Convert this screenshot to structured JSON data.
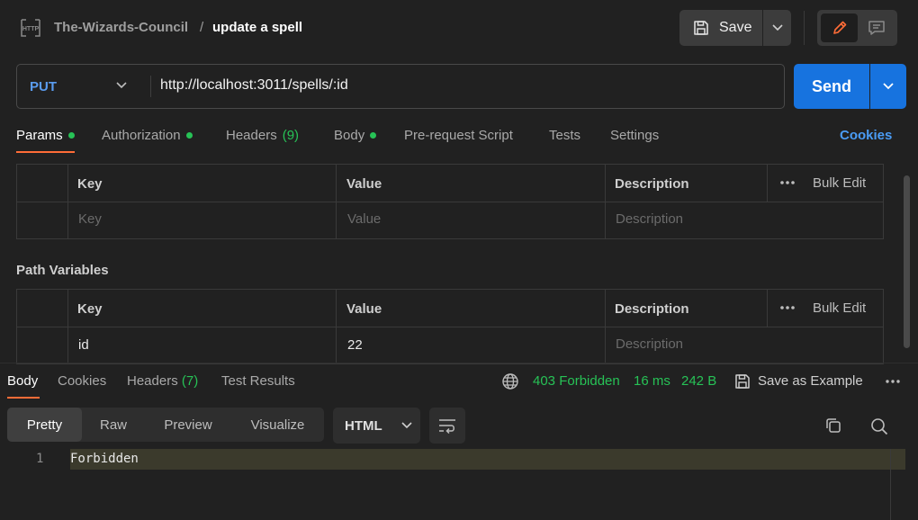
{
  "header": {
    "workspace": "The-Wizards-Council",
    "separator": "/",
    "request_name": "update a spell",
    "save_label": "Save"
  },
  "request": {
    "method": "PUT",
    "url": "http://localhost:3011/spells/:id",
    "send_label": "Send"
  },
  "tabs": {
    "params": "Params",
    "authorization": "Authorization",
    "headers": "Headers",
    "headers_count": "(9)",
    "body": "Body",
    "prerequest": "Pre-request Script",
    "tests": "Tests",
    "settings": "Settings",
    "cookies": "Cookies"
  },
  "query_params": {
    "columns": [
      "Key",
      "Value",
      "Description"
    ],
    "bulk_edit": "Bulk Edit",
    "placeholders": {
      "key": "Key",
      "value": "Value",
      "description": "Description"
    }
  },
  "path_variables": {
    "title": "Path Variables",
    "columns": [
      "Key",
      "Value",
      "Description"
    ],
    "bulk_edit": "Bulk Edit",
    "rows": [
      {
        "key": "id",
        "value": "22",
        "description_placeholder": "Description"
      }
    ]
  },
  "response": {
    "tabs": {
      "body": "Body",
      "cookies": "Cookies",
      "headers": "Headers",
      "headers_count": "(7)",
      "test_results": "Test Results"
    },
    "status": "403 Forbidden",
    "time": "16 ms",
    "size": "242 B",
    "save_example": "Save as Example",
    "views": [
      "Pretty",
      "Raw",
      "Preview",
      "Visualize"
    ],
    "format": "HTML",
    "lines": [
      {
        "number": "1",
        "text": "Forbidden"
      }
    ]
  },
  "colors": {
    "accent": "#ff6c37",
    "send": "#1773df",
    "success": "#27c256",
    "link": "#4a9cf5"
  }
}
